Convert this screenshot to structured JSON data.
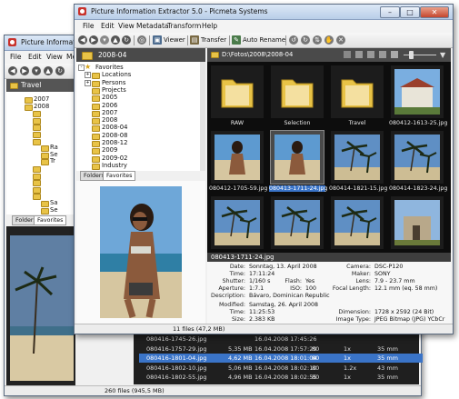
{
  "back_window": {
    "title": "Picture Information Extr",
    "menu": [
      "File",
      "Edit",
      "View",
      "Me"
    ],
    "header_folder": "Travel",
    "tree": [
      {
        "label": "2007",
        "level": 2
      },
      {
        "label": "2008",
        "level": 2
      },
      {
        "label": "",
        "level": 3
      },
      {
        "label": "",
        "level": 3
      },
      {
        "label": "",
        "level": 3
      },
      {
        "label": "",
        "level": 3
      },
      {
        "label": "",
        "level": 3
      },
      {
        "label": "Ra",
        "level": 4
      },
      {
        "label": "Se",
        "level": 4
      },
      {
        "label": "Tr",
        "level": 4
      },
      {
        "label": "",
        "level": 3
      },
      {
        "label": "",
        "level": 3
      },
      {
        "label": "",
        "level": 3
      },
      {
        "label": "",
        "level": 3
      },
      {
        "label": "",
        "level": 3
      },
      {
        "label": "Sa",
        "level": 4
      },
      {
        "label": "Se",
        "level": 4
      }
    ],
    "tabs": [
      "Folders",
      "Favorites"
    ],
    "file_rows": [
      {
        "name": "080416-1745-26.jpg",
        "size": "",
        "date": "16.04.2008 17:45:26",
        "q": "",
        "zoom": "",
        "focal": ""
      },
      {
        "name": "080416-1757-29.jpg",
        "size": "5,35 MB",
        "date": "16.04.2008 17:57:29",
        "q": "80",
        "zoom": "1x",
        "focal": "35 mm"
      },
      {
        "name": "080416-1801-04.jpg",
        "size": "4,62 MB",
        "date": "16.04.2008 18:01:04",
        "q": "80",
        "zoom": "1x",
        "focal": "35 mm"
      },
      {
        "name": "080416-1802-10.jpg",
        "size": "5,06 MB",
        "date": "16.04.2008 18:02:10",
        "q": "80",
        "zoom": "1.2x",
        "focal": "43 mm"
      },
      {
        "name": "080416-1802-55.jpg",
        "size": "4,96 MB",
        "date": "16.04.2008 18:02:55",
        "q": "80",
        "zoom": "1x",
        "focal": "35 mm"
      }
    ],
    "status": "260 files (945,5 MB)"
  },
  "front_window": {
    "title": "Picture Information Extractor 5.0 - Picmeta Systems",
    "menu": [
      "File",
      "Edit",
      "View",
      "Metadata",
      "Transform",
      "Help"
    ],
    "toolbar": {
      "viewer": "Viewer",
      "transfer": "Transfer",
      "auto_rename": "Auto Rename"
    },
    "sidebar_header": "2008-04",
    "path": "D:\\Fotos\\2008\\2008-04",
    "tree": [
      {
        "label": "Favorites",
        "level": 0,
        "expander": "-"
      },
      {
        "label": "Locations",
        "level": 1,
        "expander": "+"
      },
      {
        "label": "Persons",
        "level": 1,
        "expander": "+"
      },
      {
        "label": "Projects",
        "level": 1,
        "expander": ""
      },
      {
        "label": "2005",
        "level": 1,
        "expander": ""
      },
      {
        "label": "2006",
        "level": 1,
        "expander": ""
      },
      {
        "label": "2007",
        "level": 1,
        "expander": ""
      },
      {
        "label": "2008",
        "level": 1,
        "expander": ""
      },
      {
        "label": "2008-04",
        "level": 1,
        "expander": ""
      },
      {
        "label": "2008-08",
        "level": 1,
        "expander": ""
      },
      {
        "label": "2008-12",
        "level": 1,
        "expander": ""
      },
      {
        "label": "2009",
        "level": 1,
        "expander": ""
      },
      {
        "label": "2009-02",
        "level": 1,
        "expander": ""
      },
      {
        "label": "Industry",
        "level": 1,
        "expander": ""
      }
    ],
    "tabs": [
      "Folders",
      "Favorites"
    ],
    "thumbnails": [
      {
        "label": "RAW",
        "kind": "folder"
      },
      {
        "label": "Selection",
        "kind": "folder"
      },
      {
        "label": "Travel",
        "kind": "folder"
      },
      {
        "label": "080412-1613-25.jpg",
        "kind": "house"
      },
      {
        "label": "080412-1705-59.jpg",
        "kind": "person"
      },
      {
        "label": "080413-1711-24.jpg",
        "kind": "person",
        "selected": true
      },
      {
        "label": "080414-1821-15.jpg",
        "kind": "palm"
      },
      {
        "label": "080414-1823-24.jpg",
        "kind": "palm"
      },
      {
        "label": "",
        "kind": "palm"
      },
      {
        "label": "",
        "kind": "palm"
      },
      {
        "label": "",
        "kind": "palm"
      },
      {
        "label": "",
        "kind": "ruin"
      }
    ],
    "info_title": "080413-1711-24.jpg",
    "info_left": [
      {
        "label": "Date:",
        "value": "Sonntag, 13. April 2008"
      },
      {
        "label": "Time:",
        "value": "17:11:24"
      },
      {
        "label": "Shutter:",
        "value": "1/160 s"
      },
      {
        "label": "Aperture:",
        "value": "1:7.1"
      },
      {
        "label": "Description:",
        "value": "Bávaro, Dominican Republic"
      }
    ],
    "info_mid": [
      {
        "label": "Flash:",
        "value": "Yes"
      },
      {
        "label": "ISO:",
        "value": "100"
      }
    ],
    "info_right": [
      {
        "label": "Camera:",
        "value": "DSC-P120"
      },
      {
        "label": "Maker:",
        "value": "SONY"
      },
      {
        "label": "Lens:",
        "value": "7.9 - 23.7 mm"
      },
      {
        "label": "Focal Length:",
        "value": "12.1 mm (eq. 58 mm)"
      }
    ],
    "info_bottom_left": [
      {
        "label": "Modified:",
        "value": "Samstag, 26. April 2008"
      },
      {
        "label": "Time:",
        "value": "11:25:53"
      },
      {
        "label": "Size:",
        "value": "2.383 KB"
      }
    ],
    "info_bottom_right": [
      {
        "label": "Dimension:",
        "value": "1728 x 2592 (24 Bit)"
      },
      {
        "label": "Image Type:",
        "value": "JPEG Bitmap (JPG) YCbCr"
      }
    ],
    "status": "11 files (47,2 MB)"
  }
}
